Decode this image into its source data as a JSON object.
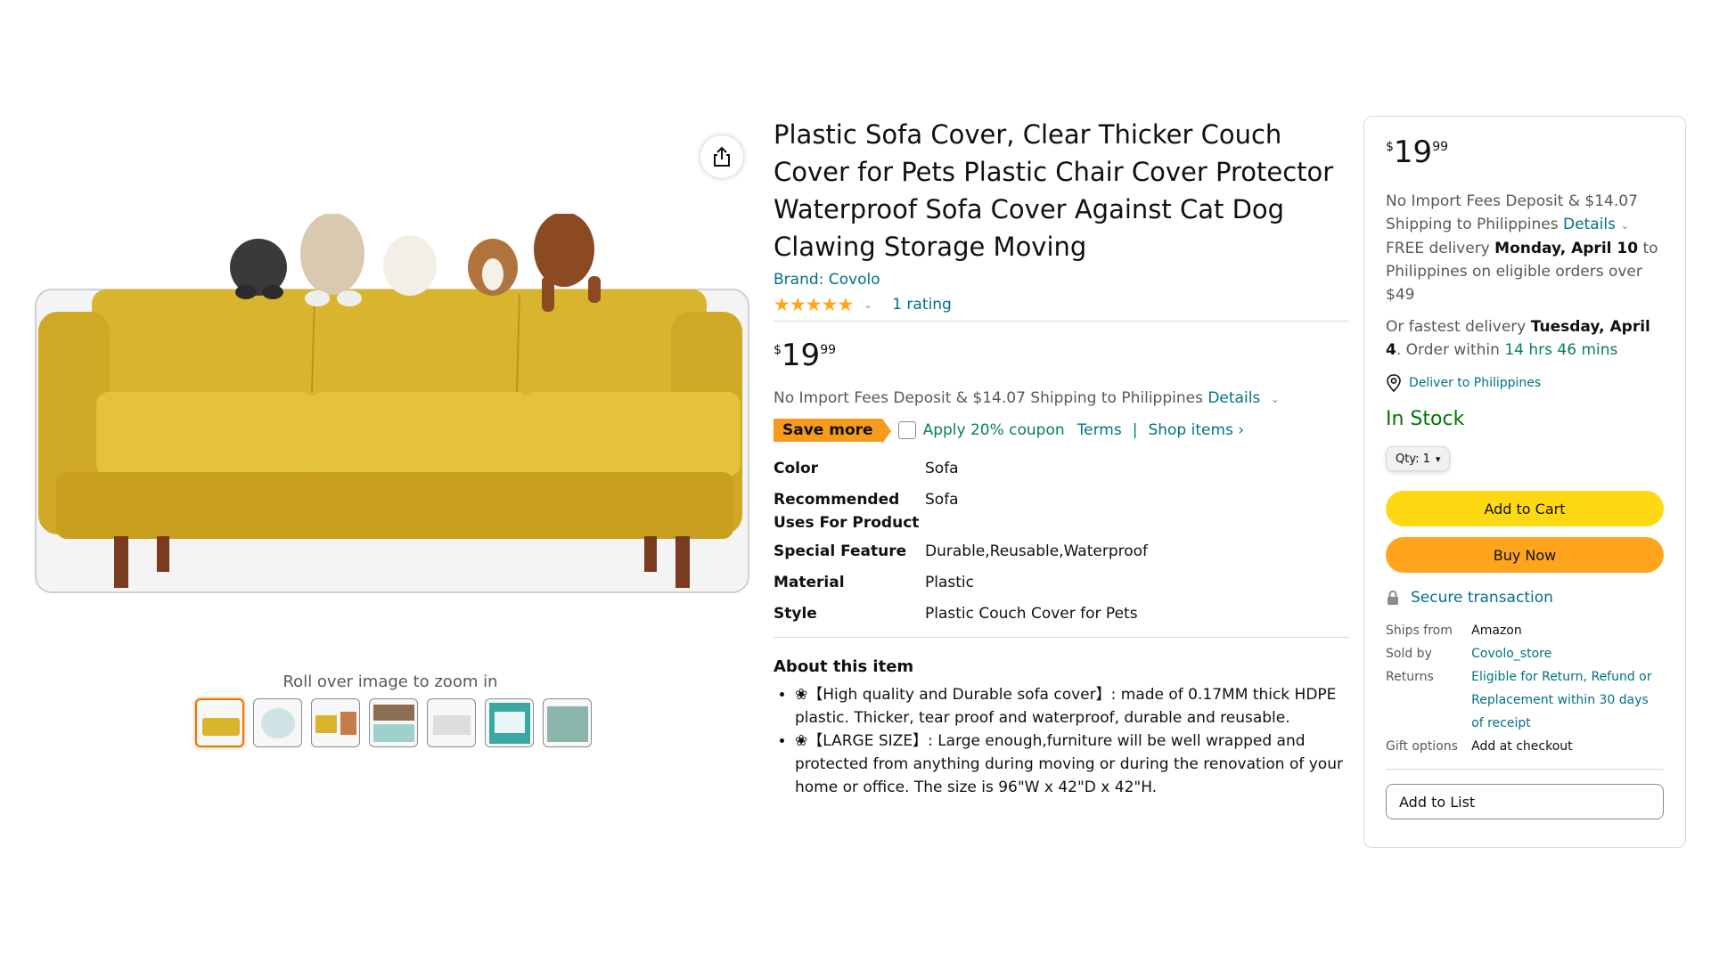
{
  "gallery": {
    "zoom_hint": "Roll over image to zoom in",
    "thumb_count": 7
  },
  "product": {
    "title": "Plastic Sofa Cover, Clear Thicker Couch Cover for Pets Plastic Chair Cover Protector Waterproof Sofa Cover Against Cat Dog Clawing Storage Moving",
    "brand": "Brand: Covolo",
    "rating_stars": 5,
    "rating_count": "1 rating",
    "price": {
      "symbol": "$",
      "whole": "19",
      "fraction": "99"
    },
    "fees_text": "No Import Fees Deposit & $14.07 Shipping to Philippines",
    "fees_link": "Details",
    "save_badge": "Save more",
    "coupon_text": "Apply 20% coupon",
    "terms_link": "Terms",
    "separator": "|",
    "shop_items_link": "Shop items ›",
    "specs": [
      {
        "k": "Color",
        "v": "Sofa"
      },
      {
        "k": "Recommended Uses For Product",
        "v": "Sofa"
      },
      {
        "k": "Special Feature",
        "v": "Durable,Reusable,Waterproof"
      },
      {
        "k": "Material",
        "v": "Plastic"
      },
      {
        "k": "Style",
        "v": "Plastic Couch Cover for Pets"
      }
    ],
    "about_heading": "About this item",
    "about": [
      "❀【High quality and Durable sofa cover】: made of 0.17MM thick HDPE plastic. Thicker, tear proof and waterproof, durable and reusable.",
      "❀【LARGE SIZE】: Large enough,furniture will be well wrapped and protected from anything during moving or during the renovation of your home or office. The size is 96\"W x 42\"D x 42\"H."
    ]
  },
  "buybox": {
    "price": {
      "symbol": "$",
      "whole": "19",
      "fraction": "99"
    },
    "fees_text": "No Import Fees Deposit & $14.07 Shipping to Philippines",
    "fees_link": "Details",
    "free_delivery_prefix": "FREE delivery",
    "free_delivery_date": "Monday, April 10",
    "free_delivery_suffix": "to Philippines on eligible orders over $49",
    "fastest_prefix": "Or fastest delivery",
    "fastest_date": "Tuesday, April 4",
    "order_within_prefix": ". Order within",
    "order_within_time": "14 hrs 46 mins",
    "deliver_to": "Deliver to Philippines",
    "stock": "In Stock",
    "qty_label": "Qty: 1",
    "add_to_cart": "Add to Cart",
    "buy_now": "Buy Now",
    "secure": "Secure transaction",
    "info": [
      {
        "k": "Ships from",
        "v": "Amazon",
        "link": false
      },
      {
        "k": "Sold by",
        "v": "Covolo_store",
        "link": true
      },
      {
        "k": "Returns",
        "v": "Eligible for Return, Refund or Replacement within 30 days of receipt",
        "link": true
      },
      {
        "k": "Gift options",
        "v": "Add at checkout",
        "link": false
      }
    ],
    "add_to_list": "Add to List"
  },
  "colors": {
    "link": "#007185",
    "star": "#ffa41c",
    "cart_button": "#ffd814",
    "buy_button": "#ffa41c",
    "in_stock": "#007600",
    "save_badge": "#f79b1d",
    "sofa": "#d9b52e"
  }
}
